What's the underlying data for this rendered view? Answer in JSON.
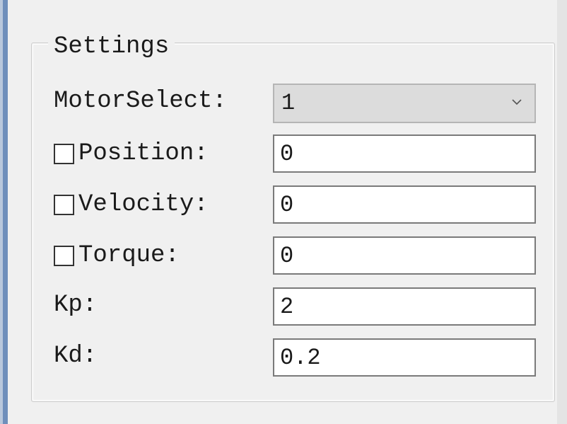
{
  "settings": {
    "title": "Settings",
    "motor_select": {
      "label": "MotorSelect:",
      "value": "1"
    },
    "position": {
      "label": "Position:",
      "checked": false,
      "value": "0"
    },
    "velocity": {
      "label": "Velocity:",
      "checked": false,
      "value": "0"
    },
    "torque": {
      "label": "Torque:",
      "checked": false,
      "value": "0"
    },
    "kp": {
      "label": "Kp:",
      "value": "2"
    },
    "kd": {
      "label": "Kd:",
      "value": "0.2"
    }
  },
  "icons": {
    "combo_arrow": "chevron-down-icon"
  },
  "colors": {
    "window_bg": "#f0f0f0",
    "left_accent": "#6f8fbb",
    "combo_bg": "#dcdcdc",
    "field_bg": "#ffffff"
  }
}
